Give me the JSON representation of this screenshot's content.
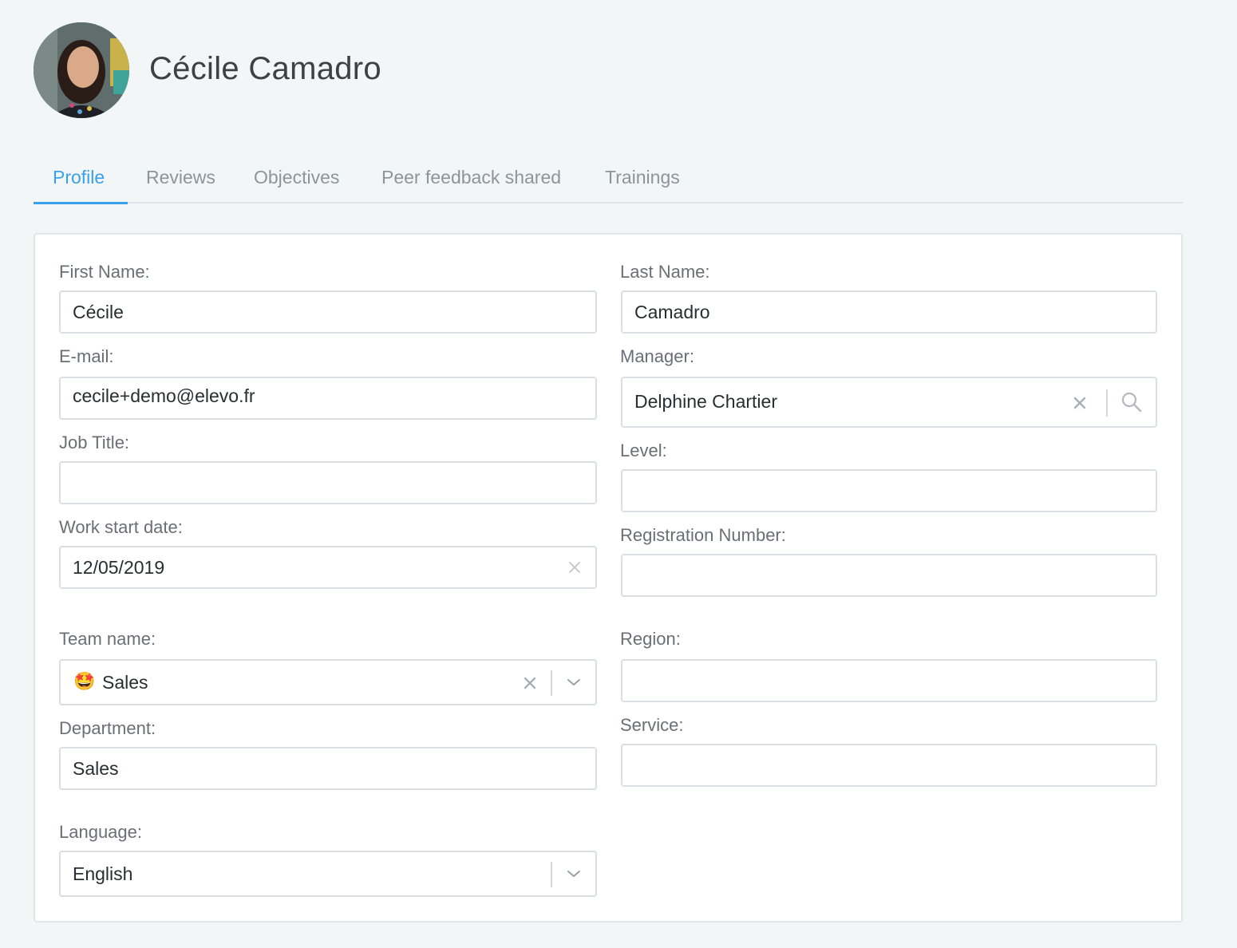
{
  "header": {
    "user_name": "Cécile Camadro",
    "avatar_icon": "user-avatar-photo"
  },
  "tabs": [
    {
      "label": "Profile",
      "active": true
    },
    {
      "label": "Reviews",
      "active": false
    },
    {
      "label": "Objectives",
      "active": false
    },
    {
      "label": "Peer feedback shared",
      "active": false
    },
    {
      "label": "Trainings",
      "active": false
    }
  ],
  "colors": {
    "accent": "#3aa0e8",
    "background": "#f3f6f7",
    "tab_inactive": "#8c959c"
  },
  "form": {
    "first_name": {
      "label": "First Name:",
      "value": "Cécile"
    },
    "last_name": {
      "label": "Last Name:",
      "value": "Camadro"
    },
    "email": {
      "label": "E-mail:",
      "value": "cecile+demo@elevo.fr"
    },
    "manager": {
      "label": "Manager:",
      "value": "Delphine Chartier",
      "clear_icon": "close-icon",
      "search_icon": "search-icon"
    },
    "job_title": {
      "label": "Job Title:",
      "value": ""
    },
    "level": {
      "label": "Level:",
      "value": ""
    },
    "work_start_date": {
      "label": "Work start date:",
      "value": "12/05/2019",
      "clear_icon": "close-icon"
    },
    "registration_number": {
      "label": "Registration Number:",
      "value": ""
    },
    "team_name": {
      "label": "Team name:",
      "value": "Sales",
      "emoji": "🤩",
      "clear_icon": "close-icon",
      "dropdown_icon": "chevron-down-icon"
    },
    "region": {
      "label": "Region:",
      "value": ""
    },
    "department": {
      "label": "Department:",
      "value": "Sales"
    },
    "service": {
      "label": "Service:",
      "value": ""
    },
    "language": {
      "label": "Language:",
      "value": "English",
      "dropdown_icon": "chevron-down-icon"
    }
  }
}
